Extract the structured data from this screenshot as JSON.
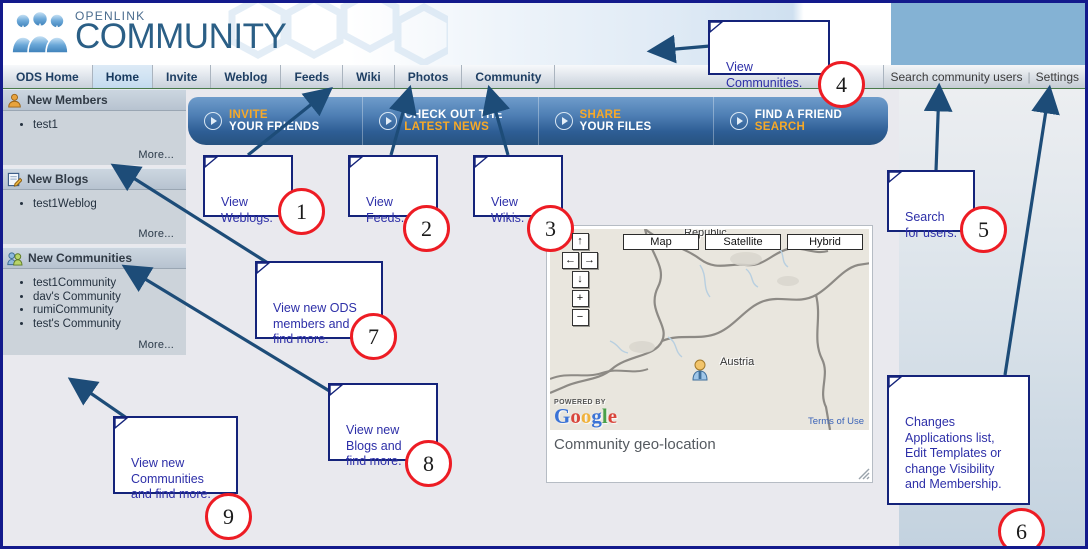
{
  "brand": {
    "top": "OPENLINK",
    "bottom": "COMMUNITY",
    "logo_icon": "community-people-logo"
  },
  "nav": {
    "tabs": [
      {
        "label": "ODS Home",
        "active": false
      },
      {
        "label": "Home",
        "active": true
      },
      {
        "label": "Invite",
        "active": false
      },
      {
        "label": "Weblog",
        "active": false
      },
      {
        "label": "Feeds",
        "active": false
      },
      {
        "label": "Wiki",
        "active": false
      },
      {
        "label": "Photos",
        "active": false
      },
      {
        "label": "Community",
        "active": false
      }
    ],
    "right_links": [
      {
        "label": "Search community users"
      },
      {
        "label": "Settings"
      }
    ],
    "separator": "|"
  },
  "promo": [
    {
      "line1": "INVITE",
      "line2": "YOUR FRIENDS",
      "line1_color": "orange",
      "line2_color": "white",
      "icon": "play-circle-icon"
    },
    {
      "line1": "CHECK OUT THE",
      "line2": "LATEST NEWS",
      "line1_color": "white",
      "line2_color": "orange",
      "icon": "play-circle-icon"
    },
    {
      "line1": "SHARE",
      "line2": "YOUR FILES",
      "line1_color": "orange",
      "line2_color": "white",
      "icon": "play-circle-icon"
    },
    {
      "line1": "FIND A FRIEND",
      "line2": "SEARCH",
      "line1_color": "white",
      "line2_color": "orange",
      "icon": "play-circle-icon"
    }
  ],
  "sidebar": {
    "panels": [
      {
        "title": "New Members",
        "icon": "single-person-icon",
        "items": [
          "test1"
        ],
        "more": "More..."
      },
      {
        "title": "New Blogs",
        "icon": "notepad-pencil-icon",
        "items": [
          "test1Weblog"
        ],
        "more": "More..."
      },
      {
        "title": "New Communities",
        "icon": "two-people-icon",
        "items": [
          "test1Community",
          "dav's Community",
          "rumiCommunity",
          "test's Community"
        ],
        "more": "More..."
      }
    ]
  },
  "map": {
    "caption": "Community geo-location",
    "type_buttons": [
      "Map",
      "Satellite",
      "Hybrid"
    ],
    "pan_controls": [
      "up-arrow",
      "left-arrow",
      "right-arrow",
      "down-arrow"
    ],
    "zoom_in": "+",
    "zoom_out": "−",
    "labels": {
      "country": "Austria",
      "partial": "Republic"
    },
    "attribution_prefix": "POWERED BY",
    "attribution_brand": "Google",
    "terms": "Terms of Use",
    "marker": "map-pin-icon"
  },
  "callouts": [
    {
      "id": "1",
      "text": "View\nWeblogs."
    },
    {
      "id": "2",
      "text": "View\nFeeds."
    },
    {
      "id": "3",
      "text": "View\nWikis."
    },
    {
      "id": "4",
      "text": "View\nCommunities."
    },
    {
      "id": "5",
      "text": "Search\nfor users."
    },
    {
      "id": "6",
      "text": "Changes\nApplications list,\nEdit Templates or\nchange Visibility\nand Membership."
    },
    {
      "id": "7",
      "text": "View new ODS\nmembers and\nfind more."
    },
    {
      "id": "8",
      "text": "View new\nBlogs and\nfind more."
    },
    {
      "id": "9",
      "text": "View new\nCommunities\nand find more."
    }
  ],
  "colors": {
    "page_border": "#131a8c",
    "callout_border": "#14237a",
    "callout_text": "#2d2fa8",
    "badge_ring": "#ed1c24",
    "arrow": "#1d4c78",
    "promo_orange": "#f7a928",
    "brand_blue": "#2b5f86"
  }
}
